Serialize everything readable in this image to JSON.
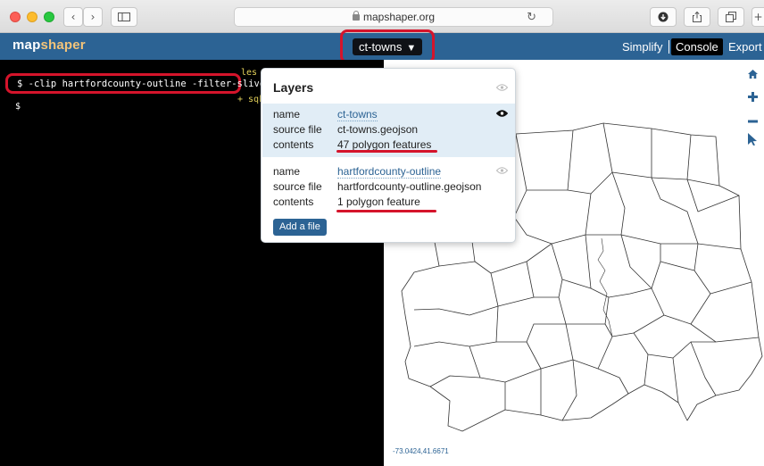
{
  "browser": {
    "url": "mapshaper.org",
    "back_glyph": "‹",
    "forward_glyph": "›",
    "reload_glyph": "↻",
    "new_tab_glyph": "+"
  },
  "app": {
    "brand_part1": "map",
    "brand_part2": "shaper",
    "layer_menu_label": "ct-towns",
    "layer_menu_arrow": "▼",
    "nav": {
      "simplify": "Simplify",
      "console": "Console",
      "export": "Export"
    }
  },
  "console": {
    "line_top_fragment": "les a",
    "command": "$ -clip hartfordcounty-outline -filter-slivers",
    "hidden_line_fragment": "+ sqkm",
    "prompt": "$"
  },
  "layers_popup": {
    "title": "Layers",
    "field_labels": {
      "name": "name",
      "source": "source file",
      "contents": "contents"
    },
    "layers": [
      {
        "name": "ct-towns",
        "source_file": "ct-towns.geojson",
        "contents": "47 polygon features",
        "selected": true,
        "visible": true
      },
      {
        "name": "hartfordcounty-outline",
        "source_file": "hartfordcounty-outline.geojson",
        "contents": "1 polygon feature",
        "selected": false,
        "visible": false
      }
    ],
    "add_file_label": "Add a file"
  },
  "map": {
    "coordinates": "-73.0424,41.6671",
    "tools": [
      "home-icon",
      "zoom-in-icon",
      "zoom-out-icon",
      "pointer-icon"
    ]
  },
  "colors": {
    "header": "#2c6394",
    "brand_accent": "#f3c47a",
    "highlight": "#d5142b",
    "selected_row": "#e1edf6"
  }
}
